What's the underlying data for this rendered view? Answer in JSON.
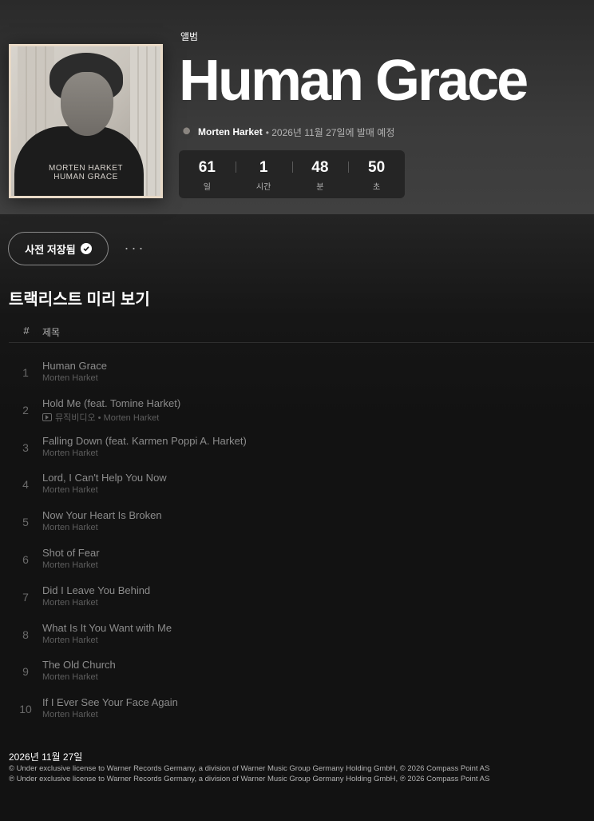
{
  "album": {
    "type_label": "앨범",
    "title": "Human Grace",
    "cover_text_line1": "MORTEN HARKET",
    "cover_text_line2": "HUMAN GRACE",
    "artist": "Morten Harket",
    "release_info": "• 2026년 11월 27일에 발매 예정"
  },
  "countdown": [
    {
      "value": "61",
      "unit": "일"
    },
    {
      "value": "1",
      "unit": "시간"
    },
    {
      "value": "48",
      "unit": "분"
    },
    {
      "value": "50",
      "unit": "초"
    }
  ],
  "actions": {
    "saved_label": "사전 저장됨",
    "more_label": "···"
  },
  "tracklist": {
    "section_title": "트랙리스트 미리 보기",
    "col_number": "#",
    "col_title": "제목",
    "tracks": [
      {
        "num": "1",
        "title": "Human Grace",
        "artist": "Morten Harket",
        "mv": false
      },
      {
        "num": "2",
        "title": "Hold Me (feat. Tomine Harket)",
        "artist": "뮤직비디오 • Morten Harket",
        "mv": true
      },
      {
        "num": "3",
        "title": "Falling Down (feat. Karmen Poppi A. Harket)",
        "artist": "Morten Harket",
        "mv": false
      },
      {
        "num": "4",
        "title": "Lord, I Can't Help You Now",
        "artist": "Morten Harket",
        "mv": false
      },
      {
        "num": "5",
        "title": "Now Your Heart Is Broken",
        "artist": "Morten Harket",
        "mv": false
      },
      {
        "num": "6",
        "title": "Shot of Fear",
        "artist": "Morten Harket",
        "mv": false
      },
      {
        "num": "7",
        "title": "Did I Leave You Behind",
        "artist": "Morten Harket",
        "mv": false
      },
      {
        "num": "8",
        "title": "What Is It You Want with Me",
        "artist": "Morten Harket",
        "mv": false
      },
      {
        "num": "9",
        "title": "The Old Church",
        "artist": "Morten Harket",
        "mv": false
      },
      {
        "num": "10",
        "title": "If I Ever See Your Face Again",
        "artist": "Morten Harket",
        "mv": false
      }
    ]
  },
  "footer": {
    "date": "2026년 11월 27일",
    "copyright": "© Under exclusive license to Warner Records Germany, a division of Warner Music Group Germany Holding GmbH, © 2026 Compass Point AS",
    "phonographic": "℗ Under exclusive license to Warner Records Germany, a division of Warner Music Group Germany Holding GmbH, ℗ 2026 Compass Point AS"
  }
}
